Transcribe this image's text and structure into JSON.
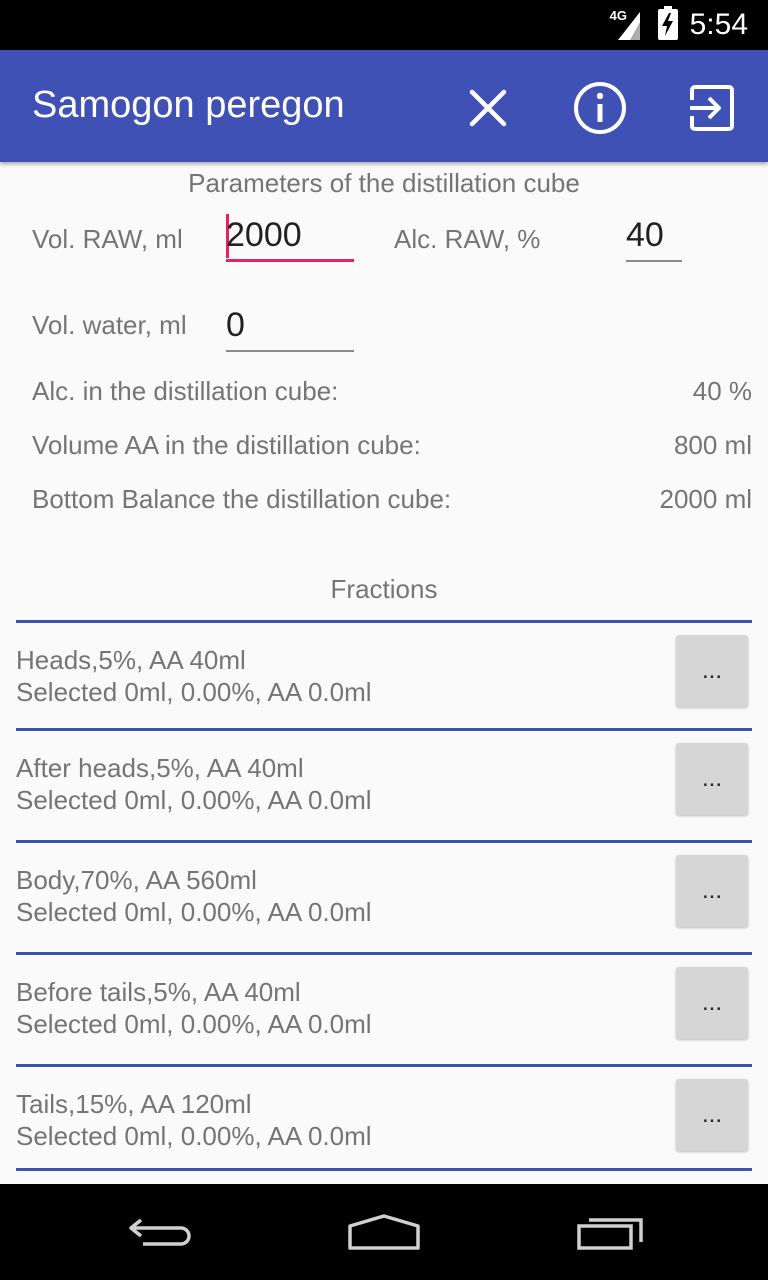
{
  "status": {
    "network": "4G",
    "time": "5:54"
  },
  "appbar": {
    "title": "Samogon peregon",
    "icons": [
      "close-icon",
      "info-icon",
      "exit-icon"
    ]
  },
  "params": {
    "title": "Parameters of the distillation cube",
    "vol_raw_label": "Vol. RAW, ml",
    "vol_raw_value": "2000",
    "alc_raw_label": "Alc. RAW, %",
    "alc_raw_value": "40",
    "vol_water_label": "Vol. water, ml",
    "vol_water_value": "0"
  },
  "results": [
    {
      "label": "Alc. in the distillation cube:",
      "value": "40 %"
    },
    {
      "label": "Volume AA in the distillation cube:",
      "value": "800 ml"
    },
    {
      "label": "Bottom Balance the distillation cube:",
      "value": "2000 ml"
    }
  ],
  "fractions": {
    "title": "Fractions",
    "items": [
      {
        "line1": "Heads,5%, AA 40ml",
        "line2": "Selected 0ml, 0.00%, AA 0.0ml",
        "button": "..."
      },
      {
        "line1": "After heads,5%, AA 40ml",
        "line2": "Selected 0ml, 0.00%, AA 0.0ml",
        "button": "..."
      },
      {
        "line1": "Body,70%, AA 560ml",
        "line2": "Selected 0ml, 0.00%, AA 0.0ml",
        "button": "..."
      },
      {
        "line1": "Before tails,5%, AA 40ml",
        "line2": "Selected 0ml, 0.00%, AA 0.0ml",
        "button": "..."
      },
      {
        "line1": "Tails,15%, AA 120ml",
        "line2": "Selected 0ml, 0.00%, AA 0.0ml",
        "button": "..."
      }
    ]
  },
  "navbar": {
    "icons": [
      "back-icon",
      "home-icon",
      "recents-icon"
    ]
  },
  "colors": {
    "primary": "#3f51b5",
    "accent": "#e91e63"
  }
}
